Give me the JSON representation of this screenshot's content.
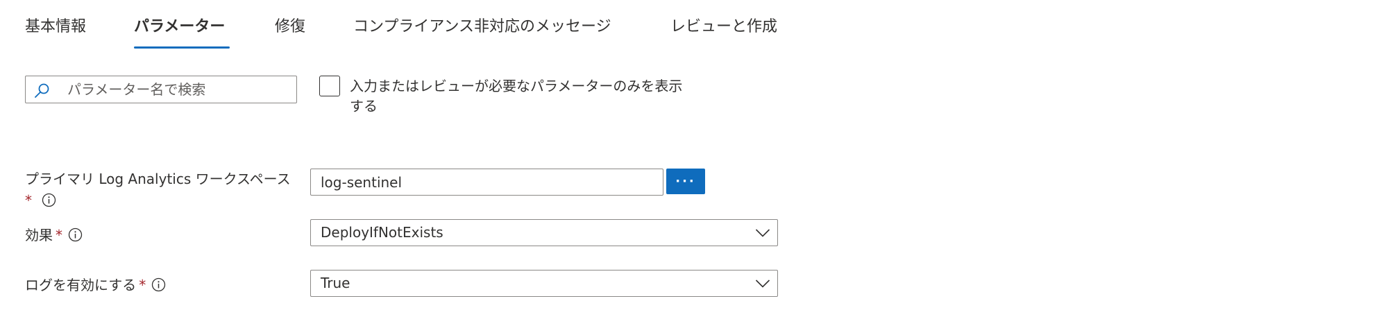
{
  "tabs": [
    {
      "label": "基本情報",
      "active": false
    },
    {
      "label": "パラメーター",
      "active": true
    },
    {
      "label": "修復",
      "active": false
    },
    {
      "label": "コンプライアンス非対応のメッセージ",
      "active": false
    },
    {
      "label": "レビューと作成",
      "active": false
    }
  ],
  "search": {
    "placeholder": "パラメーター名で検索",
    "value": "",
    "icon": "search-icon"
  },
  "filter": {
    "checked": false,
    "label_line1": "入力またはレビューが必要なパラメーターのみを表示",
    "label_line2": "する"
  },
  "parameters": {
    "workspace": {
      "label_line1": "プライマリ Log Analytics ワークスペース",
      "required_mark": "*",
      "value": "log-sentinel",
      "browse_label": "···"
    },
    "effect": {
      "label": "効果",
      "required_mark": "*",
      "value": "DeployIfNotExists"
    },
    "enable_logs": {
      "label": "ログを有効にする",
      "required_mark": "*",
      "value": "True"
    }
  },
  "colors": {
    "accent": "#0f6cbd",
    "required": "#a4262c",
    "text": "#323130",
    "border": "#8a8886"
  }
}
